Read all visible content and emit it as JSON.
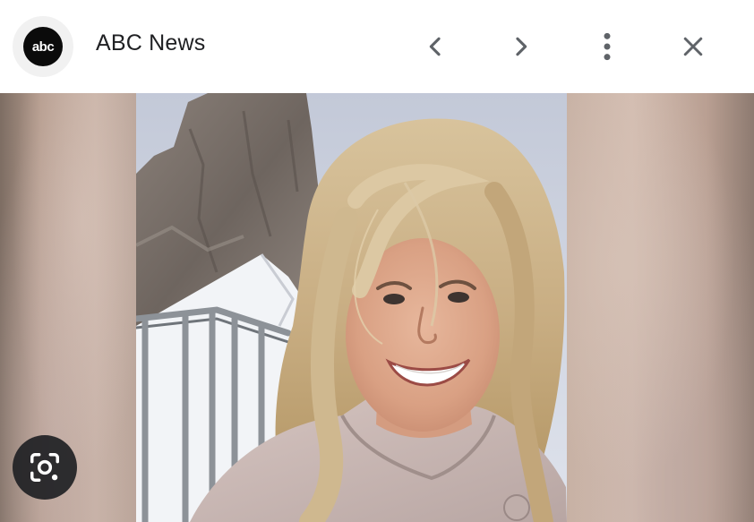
{
  "header": {
    "logo_text": "abc",
    "source_name": "ABC News",
    "prev_icon": "chevron-left-icon",
    "next_icon": "chevron-right-icon",
    "more_icon": "more-vert-icon",
    "close_icon": "close-icon"
  },
  "image": {
    "subject": "selfie",
    "lens_icon": "lens-icon"
  },
  "colors": {
    "header_bg": "#ffffff",
    "title_text": "#202124",
    "icon_color": "#5f6368",
    "logo_bg": "#0b0b0b",
    "lens_button_bg": "#202124"
  }
}
